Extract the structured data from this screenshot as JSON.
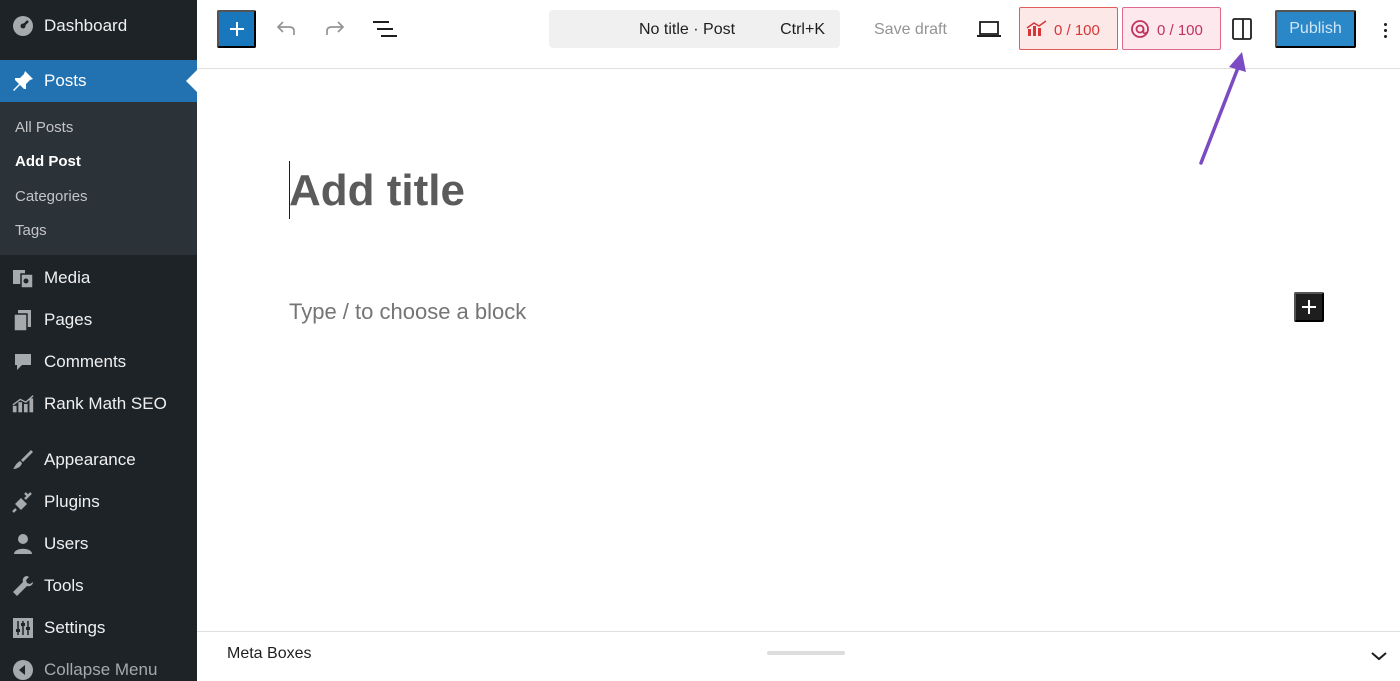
{
  "sidebar": {
    "items": [
      {
        "label": "Dashboard",
        "icon": "dashboard-icon"
      },
      {
        "label": "Posts",
        "icon": "pushpin-icon",
        "active": true
      },
      {
        "label": "Media",
        "icon": "media-icon"
      },
      {
        "label": "Pages",
        "icon": "pages-icon"
      },
      {
        "label": "Comments",
        "icon": "comments-icon"
      },
      {
        "label": "Rank Math SEO",
        "icon": "rank-math-icon"
      },
      {
        "label": "Appearance",
        "icon": "paintbrush-icon"
      },
      {
        "label": "Plugins",
        "icon": "plugin-icon"
      },
      {
        "label": "Users",
        "icon": "users-icon"
      },
      {
        "label": "Tools",
        "icon": "wrench-icon"
      },
      {
        "label": "Settings",
        "icon": "settings-icon"
      }
    ],
    "submenu": [
      {
        "label": "All Posts"
      },
      {
        "label": "Add Post",
        "current": true
      },
      {
        "label": "Categories"
      },
      {
        "label": "Tags"
      }
    ],
    "collapse_label": "Collapse Menu"
  },
  "header": {
    "document_title": "No title · Post",
    "shortcut": "Ctrl+K",
    "save_draft": "Save draft",
    "seo_score": "0 / 100",
    "content_ai_score": "0 / 100",
    "publish": "Publish"
  },
  "editor": {
    "title_placeholder": "Add title",
    "block_placeholder": "Type / to choose a block"
  },
  "metabox": {
    "title": "Meta Boxes"
  },
  "colors": {
    "sidebar_bg": "#1d2327",
    "active_menu": "#2271b1",
    "inserter_blue": "#1877bd",
    "publish_blue": "#2a88c8",
    "annotation_arrow": "#7b4bc4",
    "score_red": "#d63638"
  }
}
